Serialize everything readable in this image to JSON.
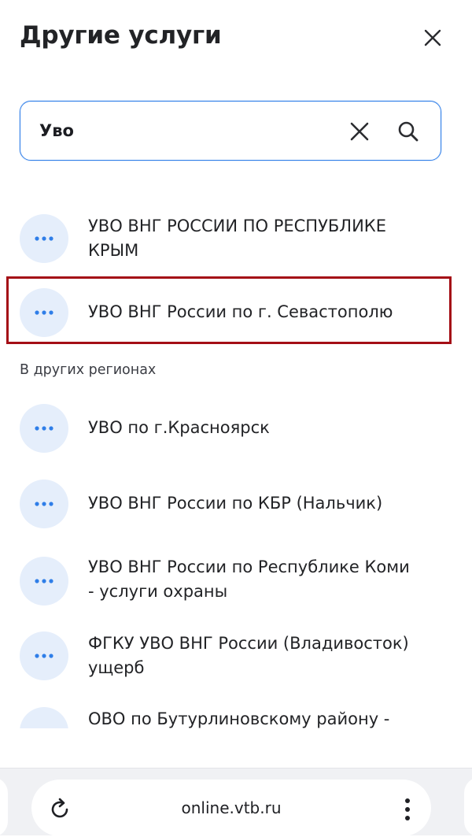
{
  "header": {
    "title": "Другие услуги"
  },
  "search": {
    "value": "Уво",
    "placeholder": ""
  },
  "results": [
    {
      "label_line1": "УВО ВНГ РОССИИ ПО РЕСПУБЛИКЕ",
      "label_line2": "КРЫМ"
    },
    {
      "label_line1": "УВО ВНГ России по г. Севастополю",
      "label_line2": "",
      "highlighted": true
    }
  ],
  "other_regions": {
    "label": "В других регионах",
    "items": [
      {
        "label_line1": "УВО по г.Красноярск",
        "label_line2": ""
      },
      {
        "label_line1": "УВО ВНГ России по КБР (Нальчик)",
        "label_line2": ""
      },
      {
        "label_line1": "УВО ВНГ России по Республике Коми",
        "label_line2": "- услуги охраны"
      },
      {
        "label_line1": "ФГКУ УВО ВНГ России (Владивосток)",
        "label_line2": "ущерб"
      },
      {
        "label_line1": "ОВО по Бутурлиновскому району -",
        "label_line2": ""
      }
    ]
  },
  "browser": {
    "url": "online.vtb.ru"
  },
  "colors": {
    "accent": "#2f7ee8",
    "icon_bg": "#e5eefb",
    "highlight": "#a40e16"
  },
  "icons": [
    "close-icon",
    "clear-icon",
    "search-icon",
    "more-dots-icon",
    "reload-icon",
    "kebab-menu-icon"
  ]
}
